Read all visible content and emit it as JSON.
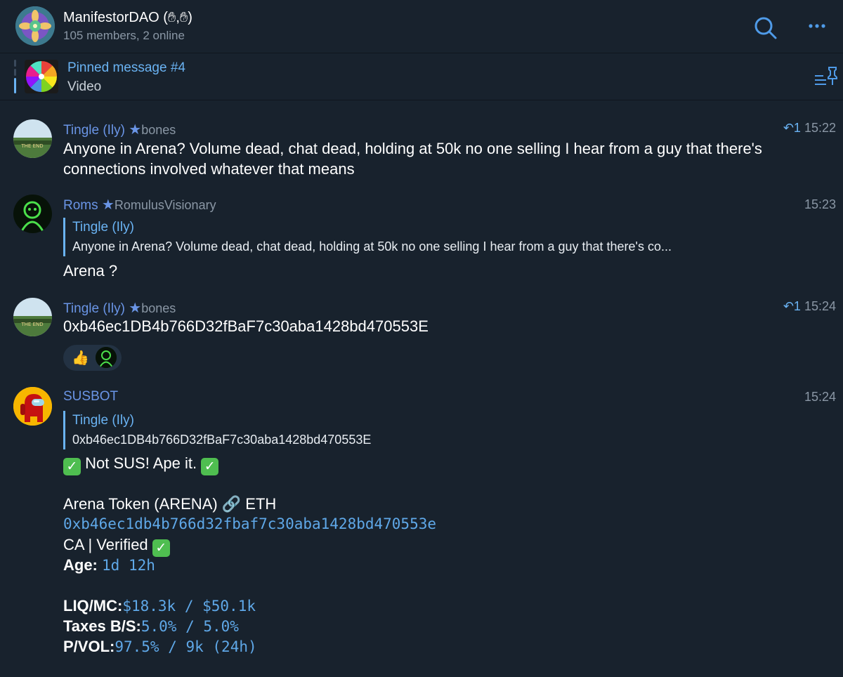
{
  "header": {
    "group_name": "ManifestorDAO (✋︎,✋︎)",
    "members": "105 members, 2 online"
  },
  "pinned": {
    "title": "Pinned message #4",
    "subtitle": "Video"
  },
  "messages": [
    {
      "sender": "Tingle (Ily)",
      "tag": "bones",
      "reply_count": "1",
      "time": "15:22",
      "text": "Anyone in Arena? Volume dead, chat dead, holding at 50k no one selling I hear from a guy that there's connections involved whatever that means"
    },
    {
      "sender": "Roms",
      "tag": "RomulusVisionary",
      "time": "15:23",
      "reply_name": "Tingle (Ily)",
      "reply_text": "Anyone in Arena? Volume dead, chat dead, holding at 50k no one selling I hear from a guy that there's co...",
      "text": "Arena ?"
    },
    {
      "sender": "Tingle (Ily)",
      "tag": "bones",
      "reply_count": "1",
      "time": "15:24",
      "text": "0xb46ec1DB4b766D32fBaF7c30aba1428bd470553E",
      "reaction": "👍"
    },
    {
      "sender": "SUSBOT",
      "time": "15:24",
      "reply_name": "Tingle (Ily)",
      "reply_text": "0xb46ec1DB4b766D32fBaF7c30aba1428bd470553E",
      "verdict": "Not SUS! Ape it.",
      "token_line": "Arena Token (ARENA) 🔗 ETH",
      "contract": "0xb46ec1db4b766d32fbaf7c30aba1428bd470553e",
      "ca_line": "CA | Verified",
      "age_label": "Age:",
      "age_value": "1d 12h",
      "liq_label": "LIQ/MC:",
      "liq_value": "$18.3k / $50.1k",
      "taxes_label": "Taxes B/S:",
      "taxes_value": "5.0% / 5.0%",
      "pvol_label": "P/VOL:",
      "pvol_value": "97.5% / 9k (24h)"
    }
  ]
}
